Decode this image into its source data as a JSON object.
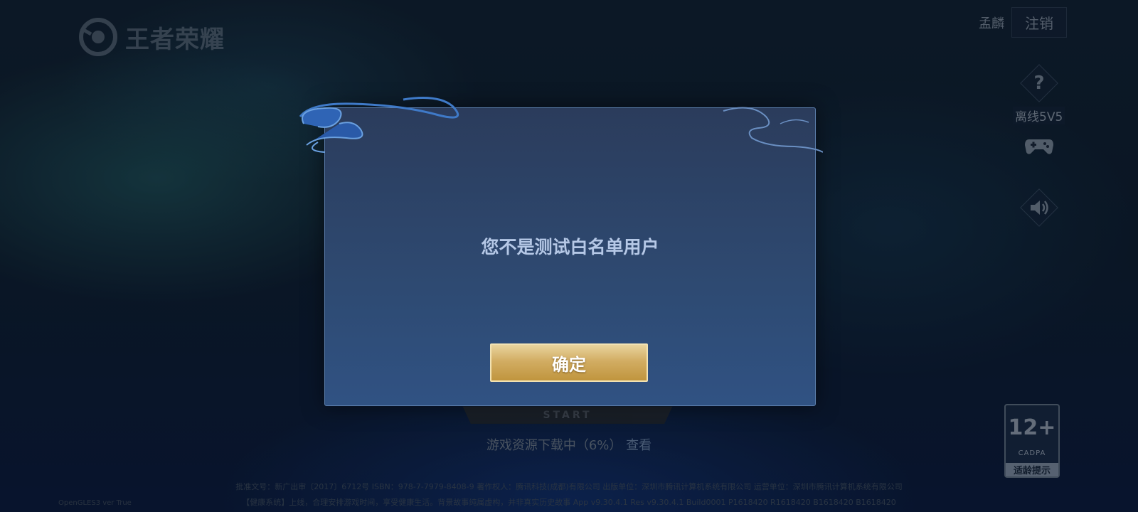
{
  "app": {
    "logo_text": "王者荣耀"
  },
  "header": {
    "username": "孟麟",
    "logout_label": "注销"
  },
  "side_menu": {
    "help_icon": "question-mark-icon",
    "offline_label": "离线5V5",
    "gamepad_icon": "gamepad-icon",
    "sound_icon": "speaker-icon"
  },
  "start_button": {
    "label": "START"
  },
  "download": {
    "status_text": "游戏资源下载中（6%）",
    "progress_percent": 6,
    "view_link": "查看"
  },
  "legal": {
    "line1": "批准文号：新广出审〔2017〕6712号  ISBN：978-7-7979-8408-9  著作权人：腾讯科技(成都)有限公司  出版单位：深圳市腾讯计算机系统有限公司  运营单位：深圳市腾讯计算机系统有限公司",
    "line2": "【健康系统】上线，合理安排游戏时间，享受健康生活。背景故事纯属虚构，并非真实历史故事  App v9.30.4.1 Res v9.30.4.1 Build0001 P1618420 R1618420 B1618420 B1618420",
    "gl_info": "OpenGLES3 ver True"
  },
  "age_rating": {
    "value": "12+",
    "org": "CADPA",
    "label": "适龄提示"
  },
  "dialog": {
    "message": "您不是测试白名单用户",
    "confirm_label": "确定"
  },
  "colors": {
    "dialog_bg": "#2e4a72",
    "dialog_border": "#5b7eaa",
    "confirm_gold": "#d2ad63",
    "message_text": "#b5c8e6"
  }
}
